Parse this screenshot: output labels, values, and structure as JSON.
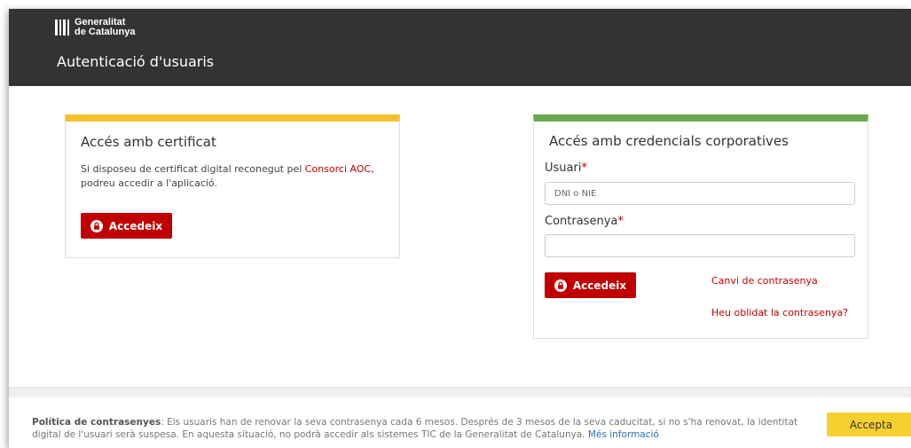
{
  "header": {
    "brand_line1": "Generalitat",
    "brand_line2": "de Catalunya",
    "title": "Autenticació d'usuaris"
  },
  "cert_card": {
    "title": "Accés amb certificat",
    "desc_before": "Si disposeu de certificat digital reconegut pel ",
    "desc_link": "Consorci AOC",
    "desc_after": ",",
    "desc_line2": "podreu accedir a l'aplicació.",
    "button_label": "Accedeix"
  },
  "cred_card": {
    "title": "Accés amb credencials corporatives",
    "user_label": "Usuari",
    "required_mark": "*",
    "user_placeholder": "DNI o NIE",
    "user_value": "",
    "password_label": "Contrasenya",
    "password_value": "",
    "button_label": "Accedeix",
    "change_password_link": "Canvi de contrasenya",
    "forgot_password_link": "Heu oblidat la contrasenya?"
  },
  "cookie_bar": {
    "policy_title": "Política de contrasenyes",
    "policy_text_line1": ": Els usuaris han de renovar la seva contrasenya cada 6 mesos. Després de 3 mesos de la seva caducitat, si no s'ha renovat, la identitat",
    "policy_text_line2": "digital de l'usuari serà suspesa. En aquesta situació, no podrà accedir als sistemes TIC de la Generalitat de Catalunya. ",
    "more_info_link": "Més informació",
    "accept_label": "Accepta"
  },
  "colors": {
    "header_bg": "#333333",
    "accent_red": "#c00000",
    "cert_top_border": "#f7c12e",
    "cred_top_border": "#6aa84f",
    "accept_yellow": "#f6d02f",
    "link_blue": "#2a70b8"
  },
  "icons": {
    "brand": "generalitat-logo-icon",
    "button": "lock-icon"
  }
}
